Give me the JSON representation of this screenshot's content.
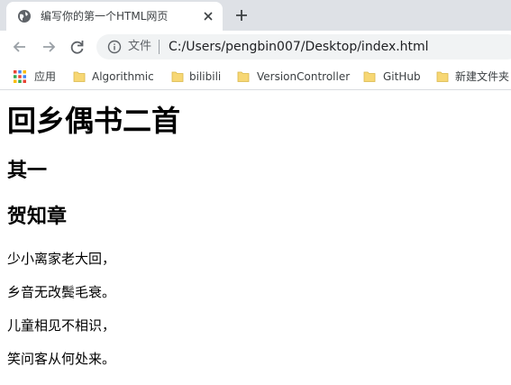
{
  "browser": {
    "tab": {
      "title": "编写你的第一个HTML网页"
    },
    "omnibox": {
      "scheme_label": "文件",
      "url": "C:/Users/pengbin007/Desktop/index.html"
    }
  },
  "bookmarks": [
    {
      "label": "应用",
      "icon": "apps-grid-icon"
    },
    {
      "label": "Algorithmic",
      "icon": "folder-icon"
    },
    {
      "label": "bilibili",
      "icon": "folder-icon"
    },
    {
      "label": "VersionController",
      "icon": "folder-icon"
    },
    {
      "label": "GitHub",
      "icon": "folder-icon"
    },
    {
      "label": "新建文件夹",
      "icon": "folder-icon"
    }
  ],
  "page": {
    "h1": "回乡偶书二首",
    "h2_part": "其一",
    "h2_author": "贺知章",
    "lines": [
      "少小离家老大回，",
      "乡音无改鬓毛衰。",
      "儿童相见不相识，",
      "笑问客从何处来。"
    ]
  },
  "colors": {
    "tabstrip": "#dee1e6",
    "omnibox": "#f1f3f4",
    "folder": "#f7d774"
  }
}
